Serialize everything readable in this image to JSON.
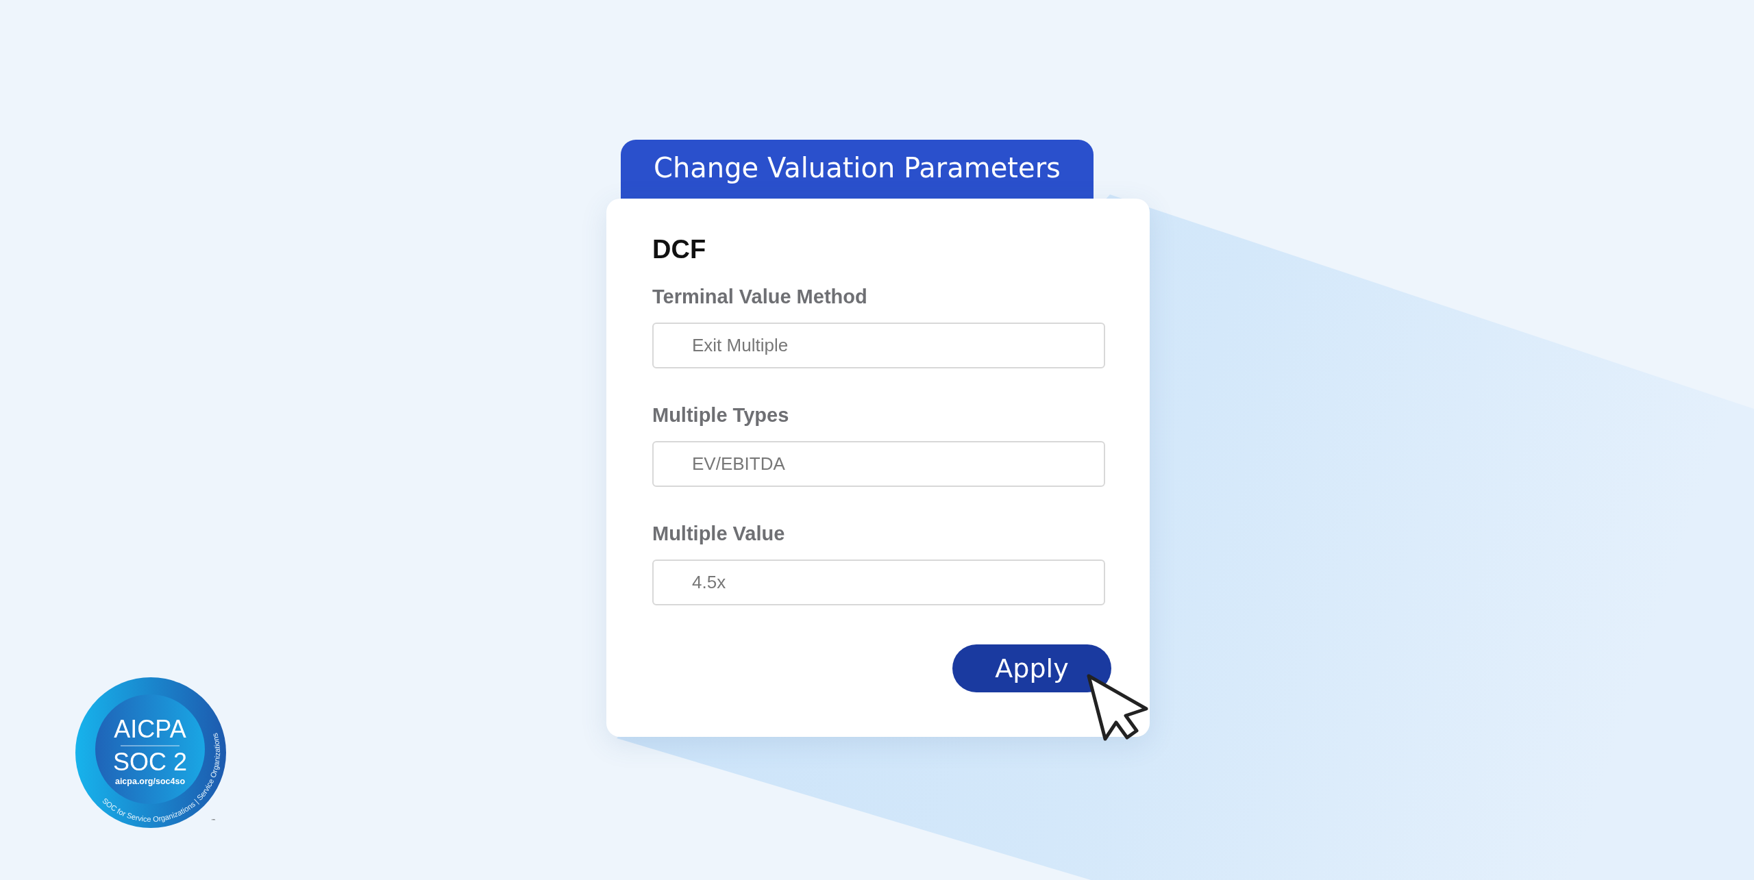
{
  "dialog": {
    "title": "Change Valuation Parameters",
    "section": "DCF",
    "fields": [
      {
        "label": "Terminal Value Method",
        "value": "Exit Multiple"
      },
      {
        "label": "Multiple Types",
        "value": "EV/EBITDA"
      },
      {
        "label": "Multiple Value",
        "value": "4.5x"
      }
    ],
    "apply_button": "Apply"
  },
  "badge": {
    "title": "AICPA",
    "subtitle": "SOC 2",
    "url": "aicpa.org/soc4so",
    "ring_text": "SOC for Service Organizations | Service Organizations",
    "trademark": "™"
  }
}
